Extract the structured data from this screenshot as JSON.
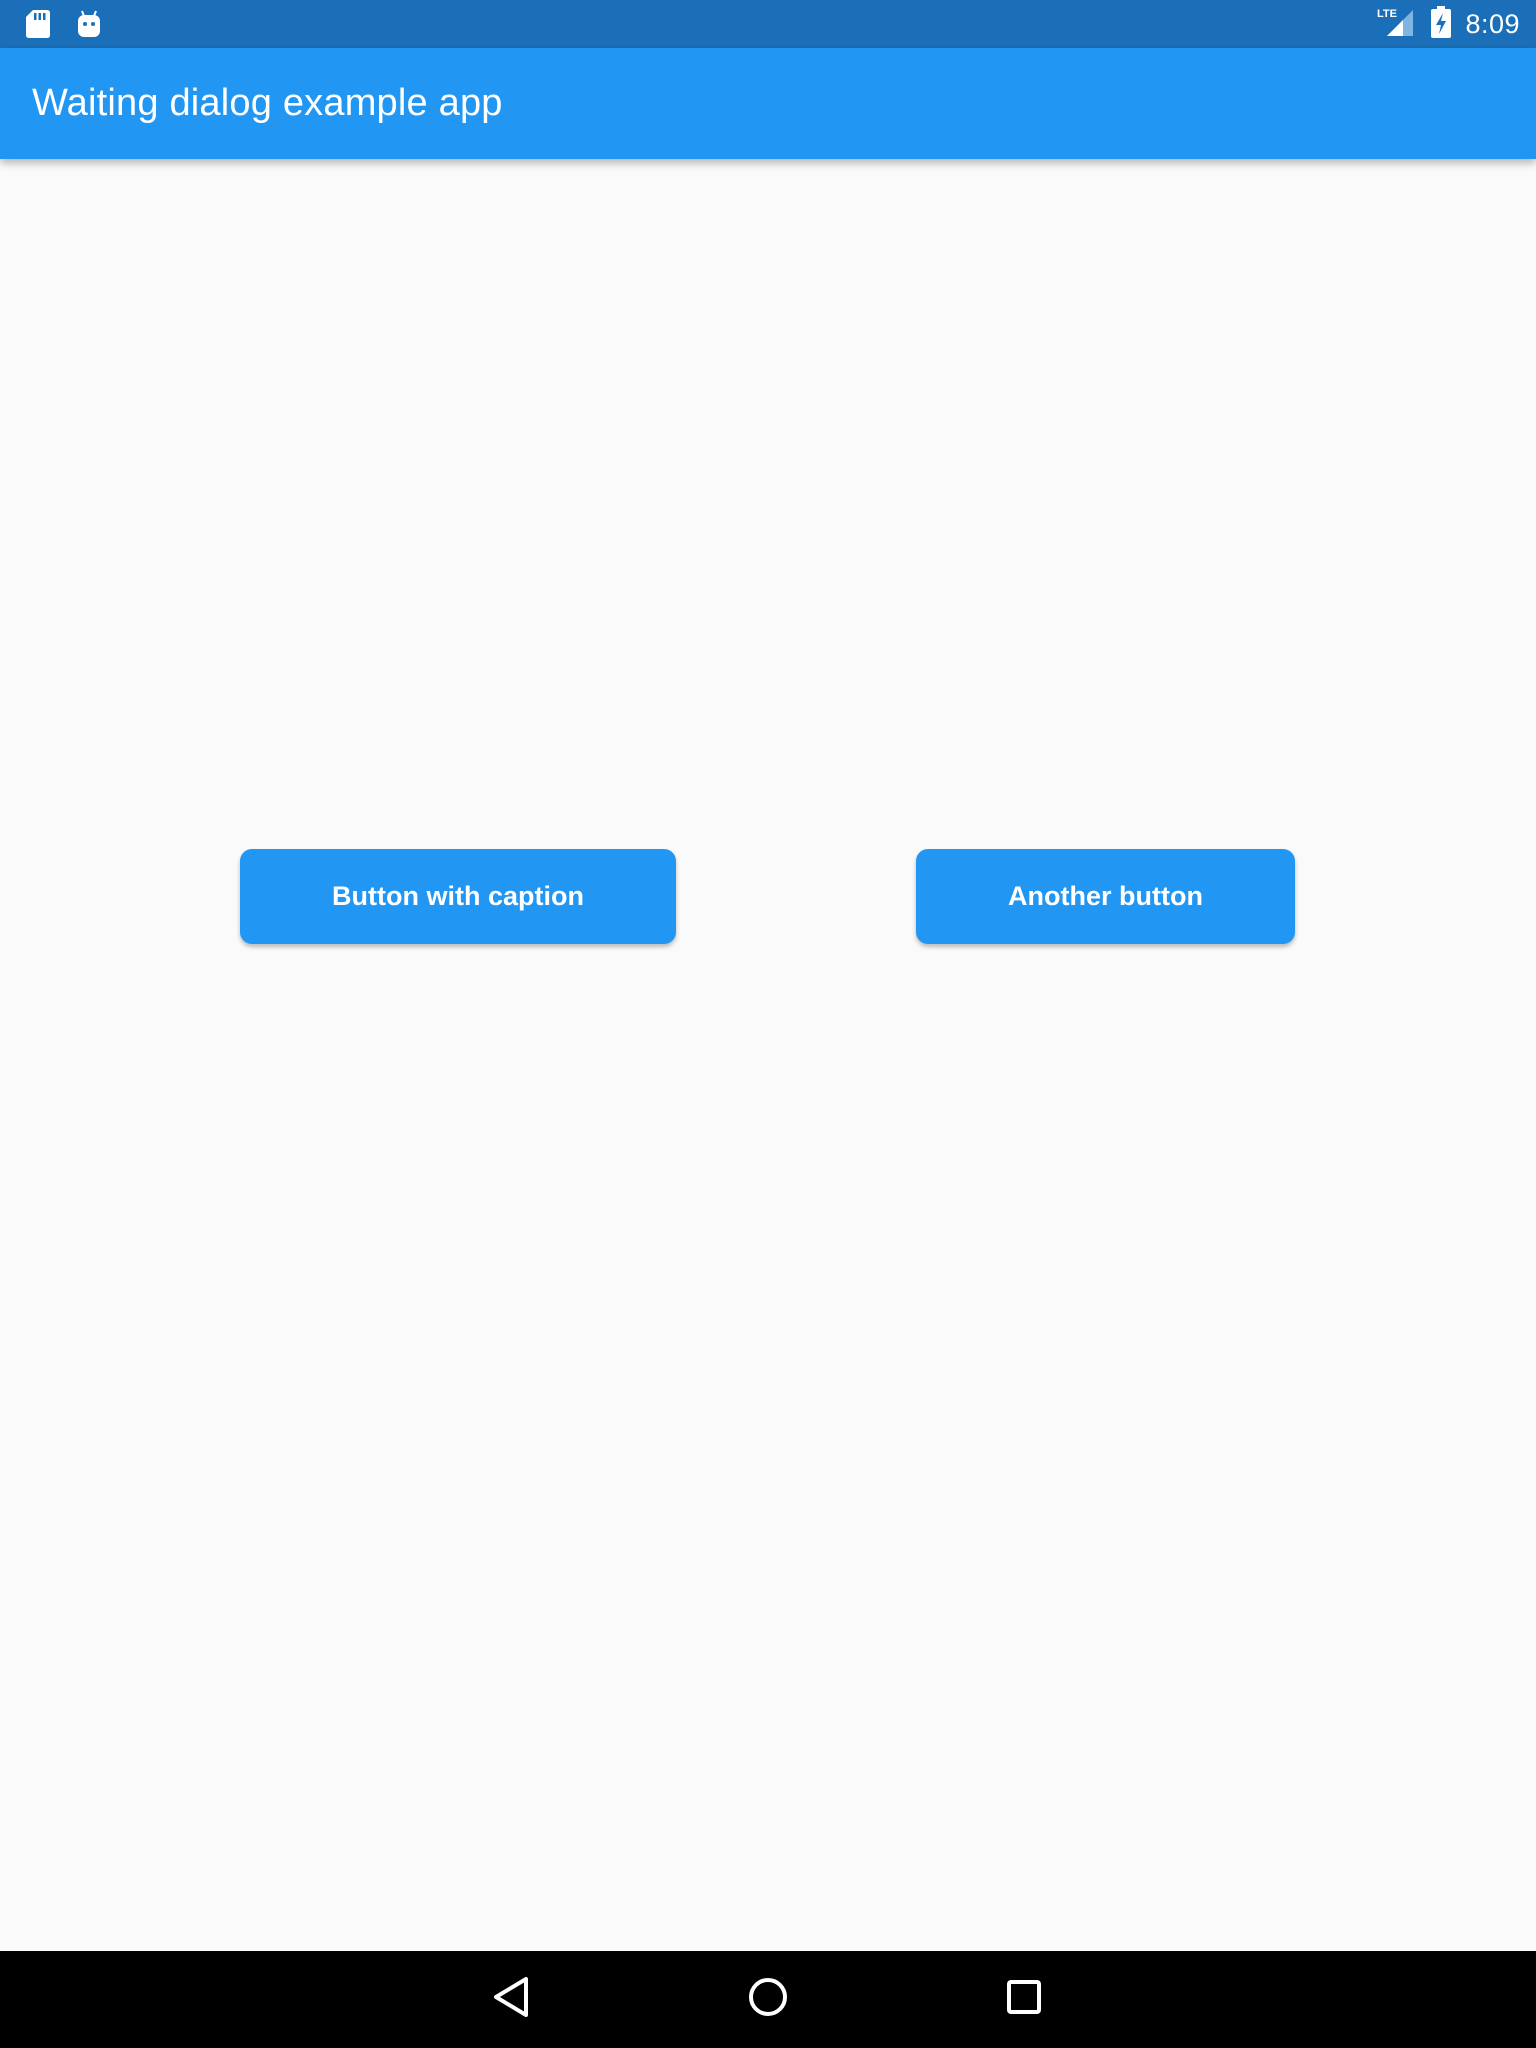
{
  "status_bar": {
    "time": "8:09",
    "network_label": "LTE",
    "icons": [
      "sd-card-icon",
      "android-icon",
      "lte-signal-icon",
      "battery-charging-icon"
    ]
  },
  "app_bar": {
    "title": "Waiting dialog example app"
  },
  "buttons": {
    "caption_label": "Button with caption",
    "another_label": "Another button"
  },
  "nav_bar": {
    "icons": [
      "back-icon",
      "home-icon",
      "recents-icon"
    ]
  },
  "colors": {
    "status_bar": "#1a6fb8",
    "app_bar": "#2196f3",
    "button": "#2196f3",
    "background": "#fafafa",
    "nav_bar": "#000000"
  }
}
